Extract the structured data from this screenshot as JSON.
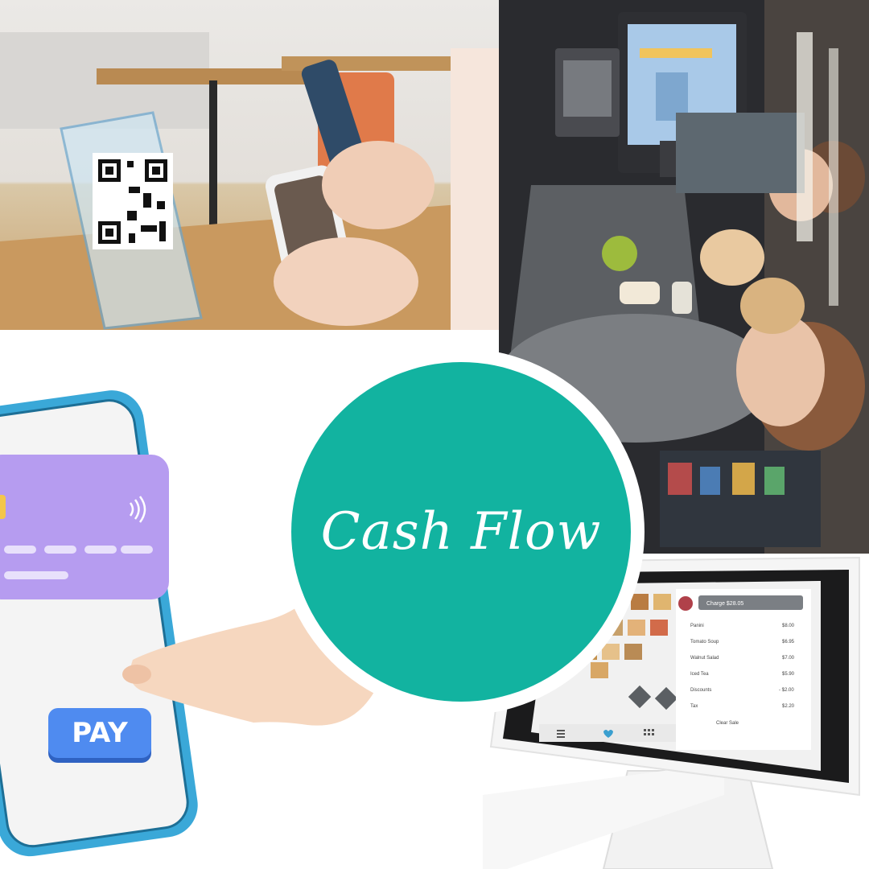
{
  "logo": {
    "text": "Cash Flow",
    "color": "#12b3a0"
  },
  "phone_pay": {
    "button_label": "PAY"
  },
  "pos_screen": {
    "charge_button": "Charge $28.05",
    "items": [
      {
        "name": "Panini",
        "price": "$8.00"
      },
      {
        "name": "Tomato Soup",
        "price": "$6.95"
      },
      {
        "name": "Walnut Salad",
        "price": "$7.00"
      },
      {
        "name": "Iced Tea",
        "price": "$5.90"
      },
      {
        "name": "Discounts",
        "price": "- $2.00"
      },
      {
        "name": "Tax",
        "price": "$2.20"
      }
    ],
    "clear_sale": "Clear Sale"
  }
}
